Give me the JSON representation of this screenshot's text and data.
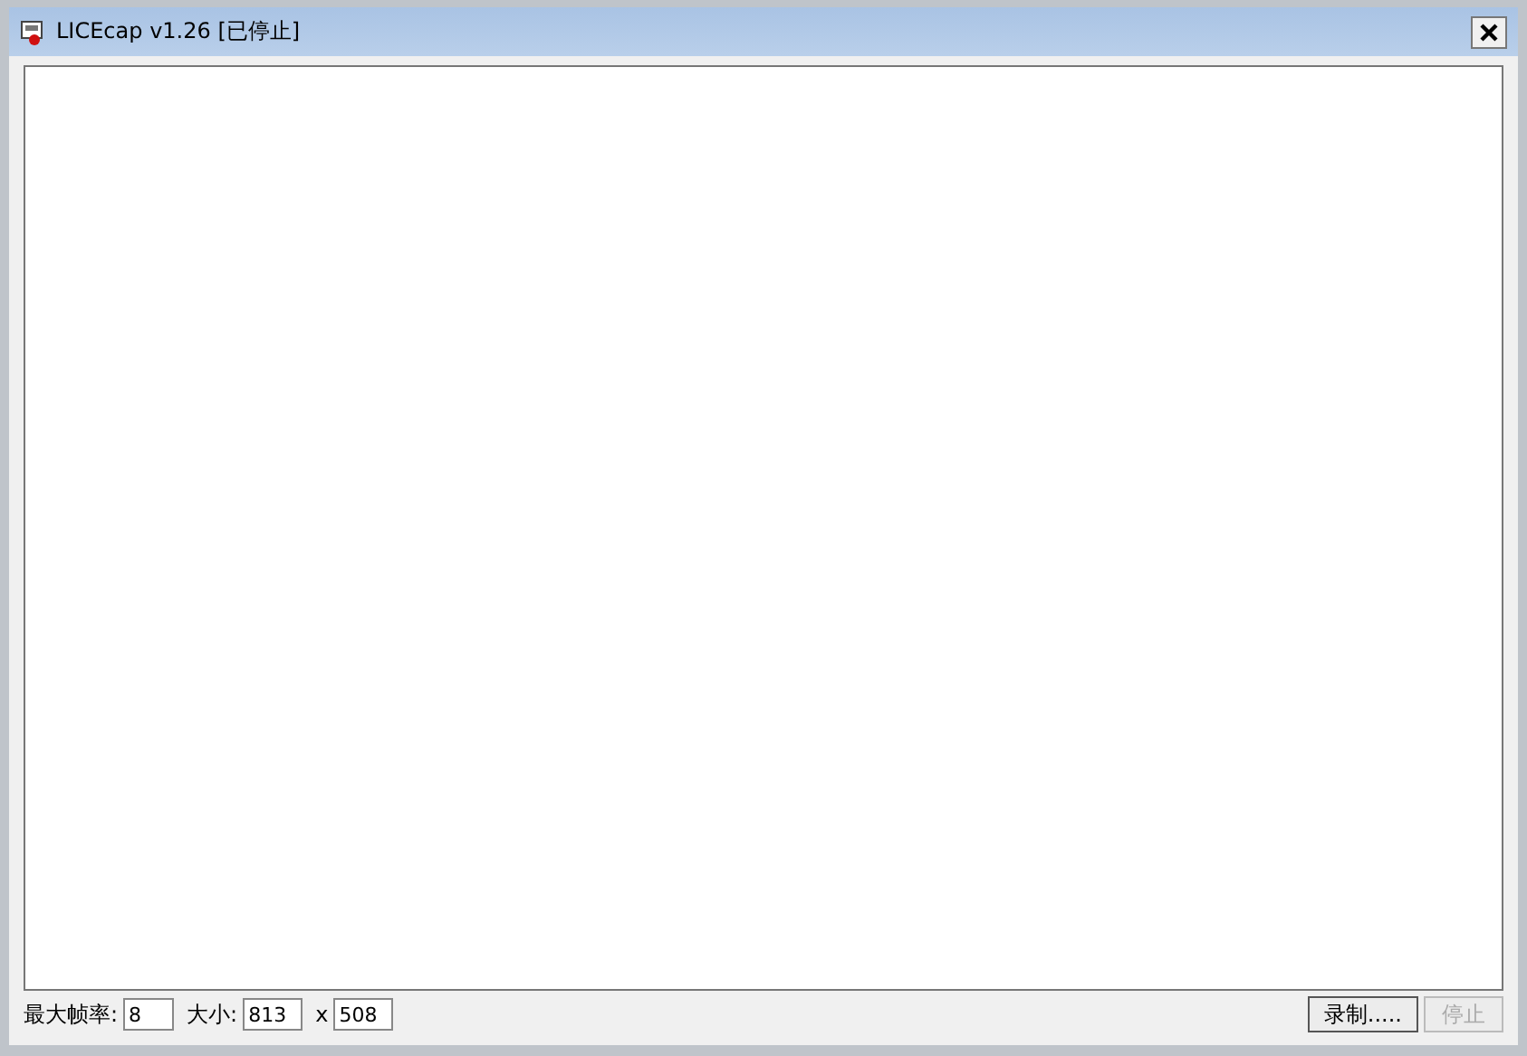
{
  "window": {
    "title": "LICEcap v1.26 [已停止]"
  },
  "controls": {
    "fps_label": "最大帧率:",
    "fps_value": "8",
    "size_label": "大小:",
    "width_value": "813",
    "separator": "x",
    "height_value": "508"
  },
  "buttons": [
    {
      "label": "录制.....",
      "disabled": false
    },
    {
      "label": "停止",
      "disabled": true
    }
  ]
}
